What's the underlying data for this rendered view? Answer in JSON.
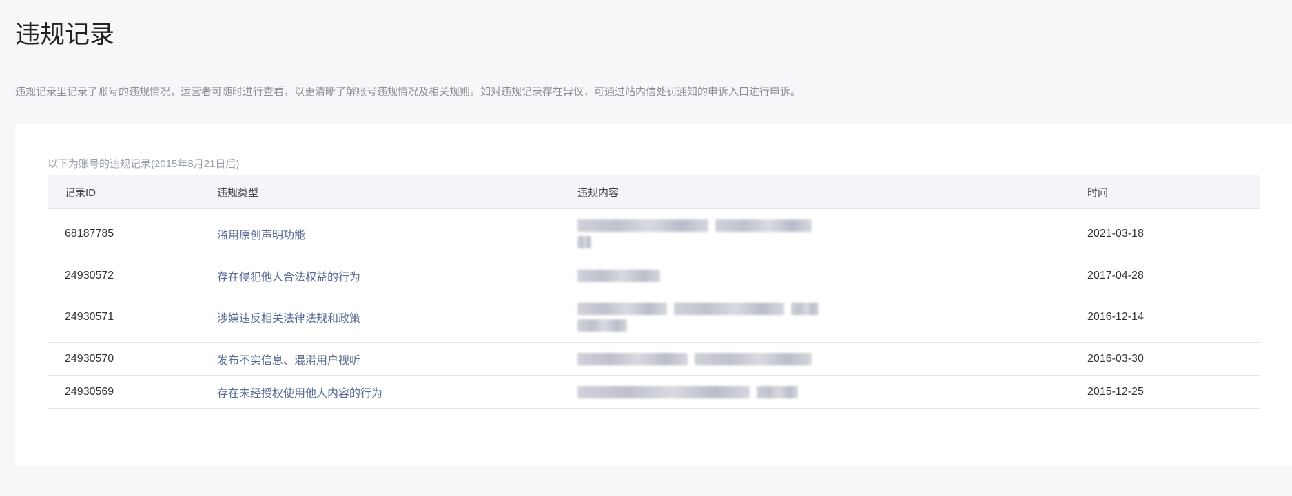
{
  "page": {
    "title": "违规记录",
    "description": "违规记录里记录了账号的违规情况，运营者可随时进行查看，以更清晰了解账号违规情况及相关规则。如对违规记录存在异议，可通过站内信处罚通知的申诉入口进行申诉。"
  },
  "records": {
    "caption": "以下为账号的违规记录(2015年8月21日后)",
    "columns": {
      "id": "记录ID",
      "type": "违规类型",
      "content": "违规内容",
      "time": "时间"
    },
    "rows": [
      {
        "id": "68187785",
        "type": "滥用原创声明功能",
        "time": "2021-03-18"
      },
      {
        "id": "24930572",
        "type": "存在侵犯他人合法权益的行为",
        "time": "2017-04-28"
      },
      {
        "id": "24930571",
        "type": "涉嫌违反相关法律法规和政策",
        "time": "2016-12-14"
      },
      {
        "id": "24930570",
        "type": "发布不实信息、混淆用户视听",
        "time": "2016-03-30"
      },
      {
        "id": "24930569",
        "type": "存在未经授权使用他人内容的行为",
        "time": "2015-12-25"
      }
    ]
  },
  "colors": {
    "link": "#576b95",
    "page_bg": "#f6f7f9",
    "card_bg": "#ffffff",
    "header_bg": "#f4f5f8",
    "border": "#e3e5e9"
  }
}
